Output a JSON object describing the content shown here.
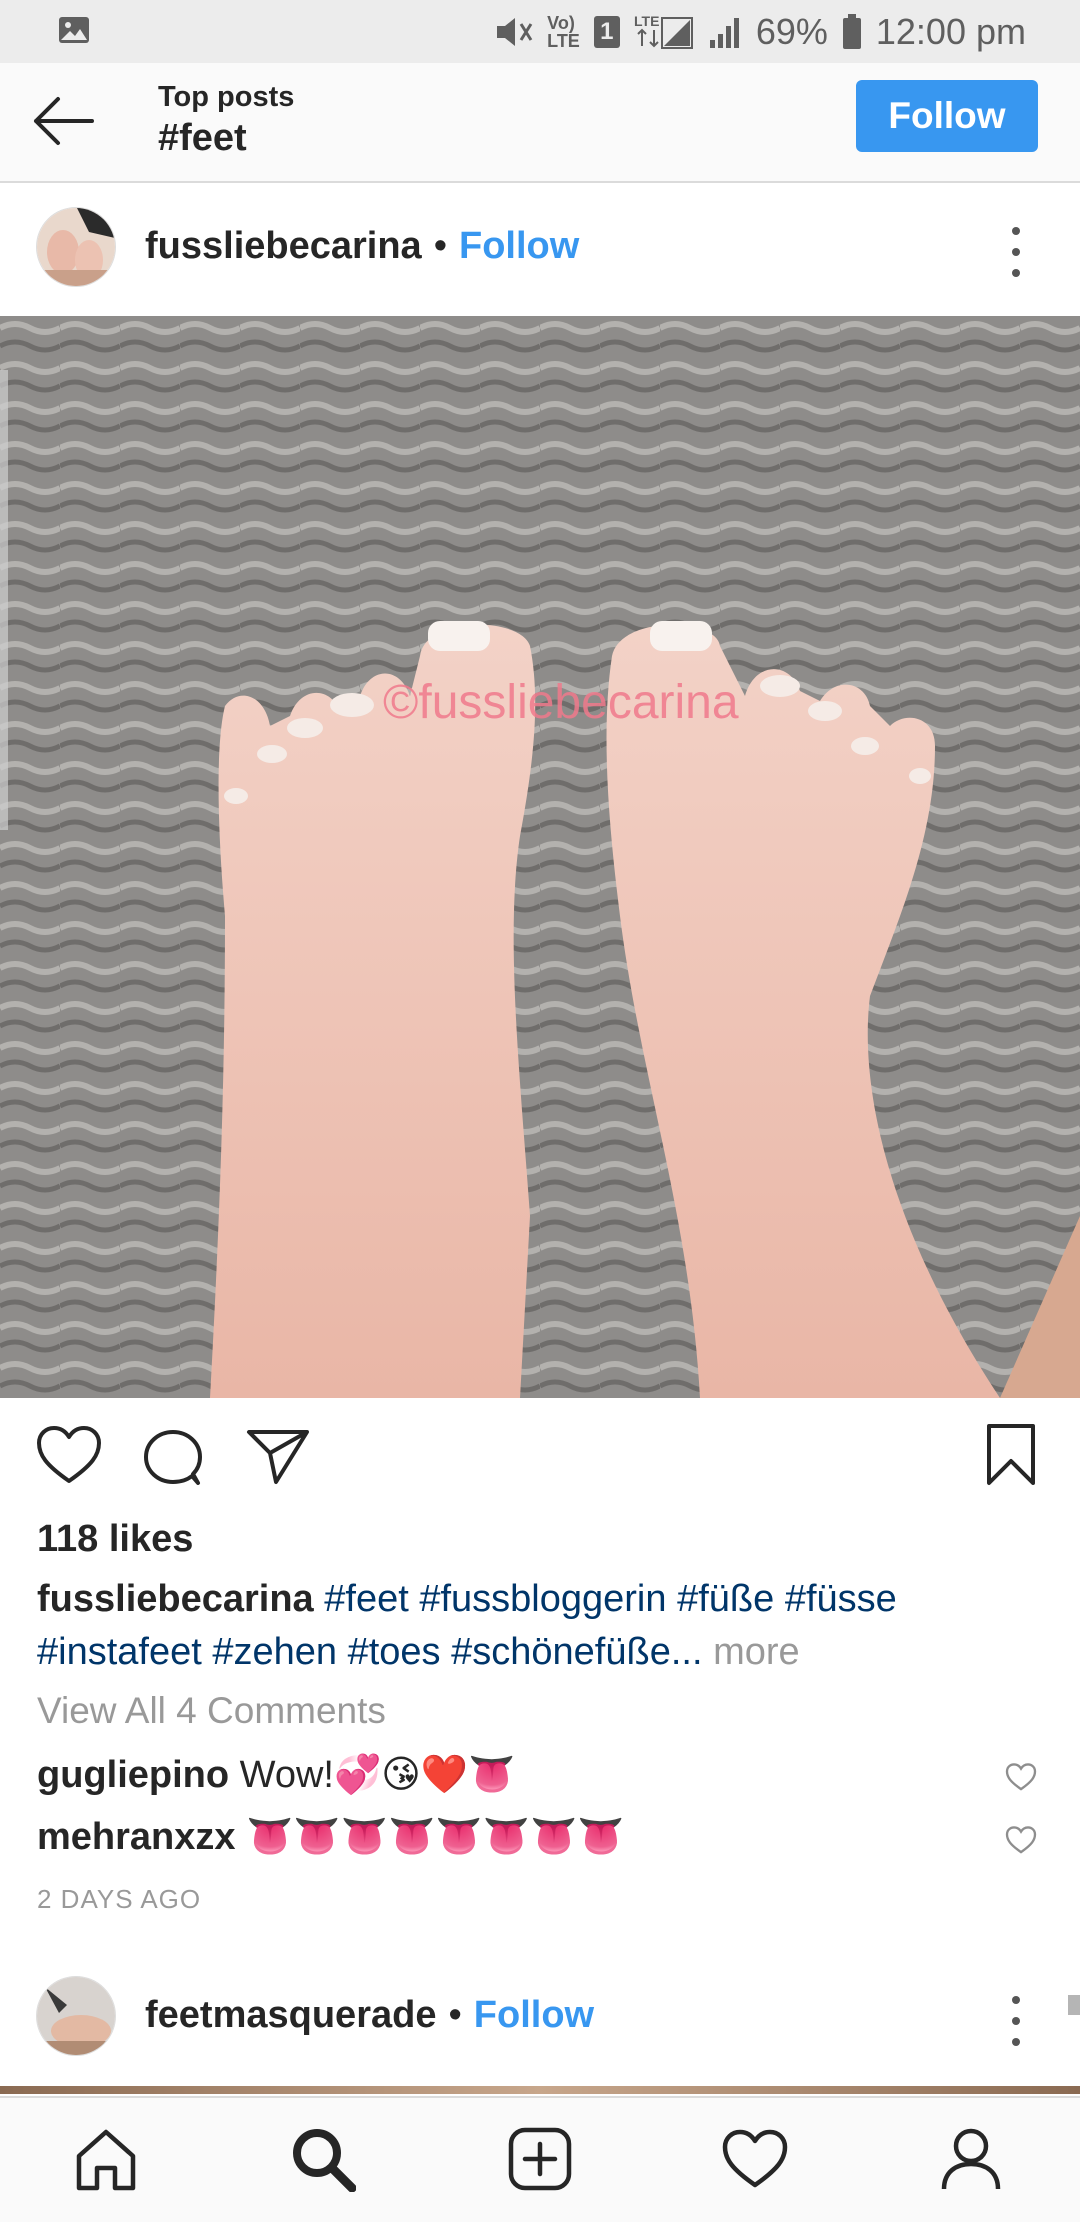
{
  "status_bar": {
    "battery": "69%",
    "time": "12:00 pm",
    "notification_count": "1",
    "network": "LTE"
  },
  "header": {
    "subtitle": "Top posts",
    "title": "#feet",
    "follow_label": "Follow"
  },
  "post": {
    "username": "fussliebecarina",
    "separator": "•",
    "follow_label": "Follow",
    "watermark": "©fussliebecarina",
    "likes": "118 likes",
    "caption": {
      "username": "fussliebecarina",
      "tags_line1": [
        "#feet",
        "#fussbloggerin",
        "#füße",
        "#füsse"
      ],
      "tags_line2": [
        "#instafeet",
        "#zehen",
        "#toes",
        "#schönefüße"
      ],
      "ellipsis": "...",
      "more_label": "more"
    },
    "view_all_comments": "View All 4 Comments",
    "comments": [
      {
        "user": "gugliepino",
        "text": "Wow!💞😘❤️👅"
      },
      {
        "user": "mehranxzx",
        "text": "👅👅👅👅👅👅👅👅"
      }
    ],
    "date": "2 DAYS AGO"
  },
  "next_post": {
    "username": "feetmasquerade",
    "separator": "•",
    "follow_label": "Follow"
  },
  "colors": {
    "accent": "#3897f0",
    "hashtag": "#003569",
    "muted": "#999999",
    "watermark": "#f07a8c"
  },
  "icons": {
    "back": "arrow-left-icon",
    "like": "heart-icon",
    "comment": "comment-bubble-icon",
    "share": "paper-plane-icon",
    "save": "bookmark-icon",
    "nav": [
      "home-icon",
      "search-icon",
      "add-post-icon",
      "activity-heart-icon",
      "profile-icon"
    ]
  }
}
